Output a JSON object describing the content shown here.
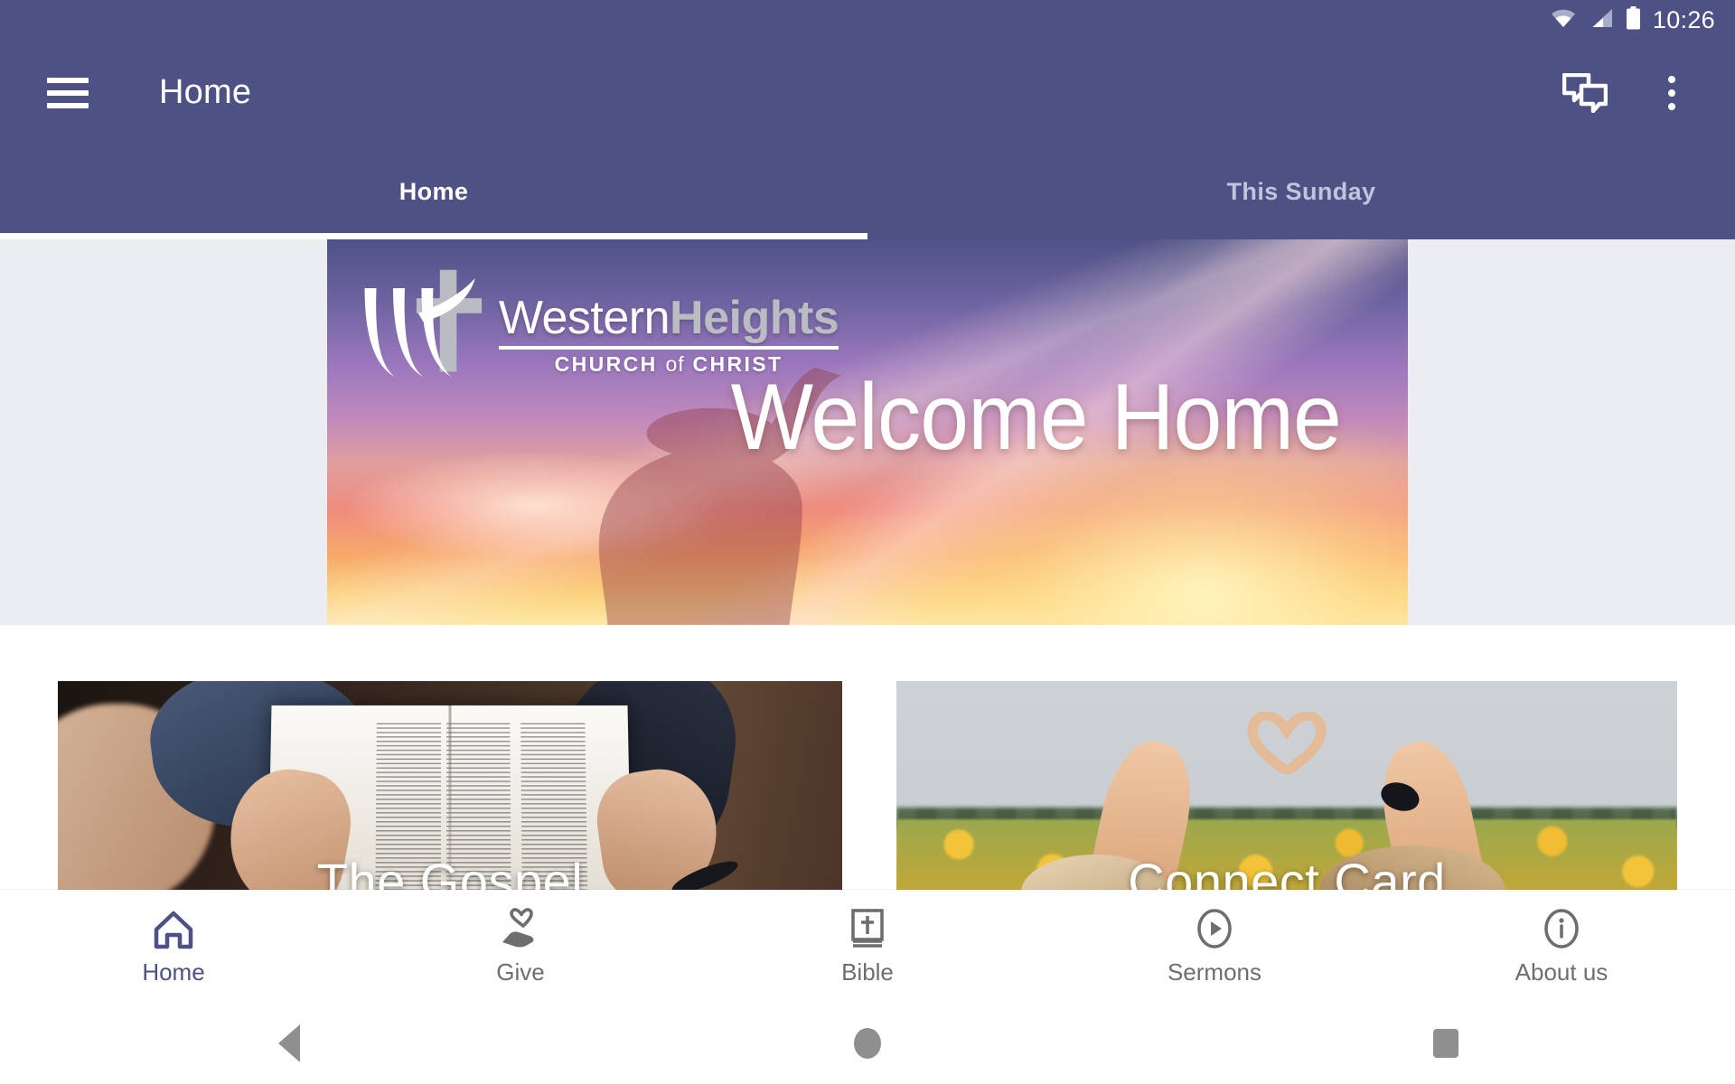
{
  "status_bar": {
    "time": "10:26",
    "icons": [
      "wifi-icon",
      "cellular-signal-icon",
      "battery-icon"
    ]
  },
  "app_bar": {
    "menu_icon": "hamburger-menu-icon",
    "title": "Home",
    "actions": [
      {
        "name": "chat-icon",
        "label": "Chat"
      },
      {
        "name": "overflow-menu-icon",
        "label": "More options"
      }
    ]
  },
  "tabs": [
    {
      "label": "Home",
      "active": true
    },
    {
      "label": "This Sunday",
      "active": false
    }
  ],
  "hero": {
    "logo": {
      "name_part1": "Western",
      "name_part2": "Heights",
      "subtitle_before": "CHURCH",
      "subtitle_of": "of",
      "subtitle_after": "CHRIST",
      "mark": "stylized-w-with-cross"
    },
    "headline": "Welcome Home"
  },
  "cards": [
    {
      "title": "The Gospel",
      "image": "person-reading-open-bible",
      "truncated": true
    },
    {
      "title": "Connect Card",
      "image": "hands-forming-heart-in-sunflower-field",
      "truncated": true
    }
  ],
  "bottom_nav": [
    {
      "label": "Home",
      "icon": "home-icon",
      "active": true
    },
    {
      "label": "Give",
      "icon": "hand-holding-heart-icon",
      "active": false
    },
    {
      "label": "Bible",
      "icon": "bible-book-icon",
      "active": false
    },
    {
      "label": "Sermons",
      "icon": "play-circle-icon",
      "active": false
    },
    {
      "label": "About us",
      "icon": "info-circle-icon",
      "active": false
    }
  ],
  "system_nav": [
    {
      "name": "back-button",
      "icon": "triangle-back-icon"
    },
    {
      "name": "home-button",
      "icon": "circle-home-icon"
    },
    {
      "name": "recents-button",
      "icon": "square-recents-icon"
    }
  ],
  "colors": {
    "primary": "#4e5184",
    "tab_inactive": "#c2c4dc",
    "page_background": "#ecedf0",
    "nav_inactive": "#6e6e6e"
  }
}
